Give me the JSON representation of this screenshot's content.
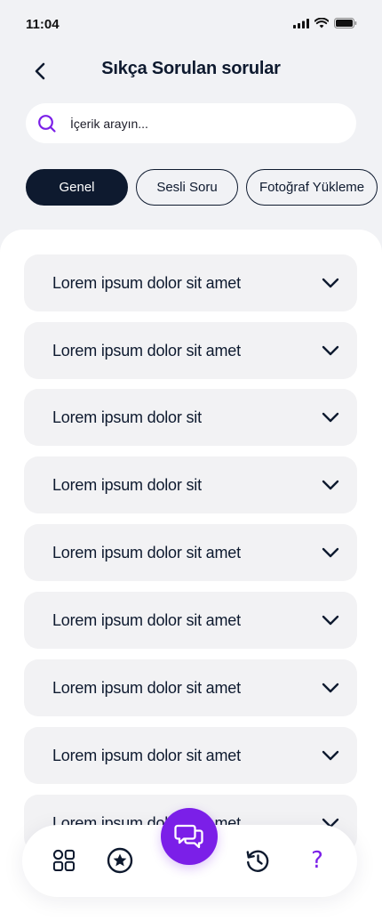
{
  "status_bar": {
    "time": "11:04"
  },
  "header": {
    "title": "Sıkça Sorulan sorular"
  },
  "search": {
    "placeholder": "İçerik arayın..."
  },
  "filters": {
    "chips": [
      {
        "label": "Genel",
        "active": true
      },
      {
        "label": "Sesli Soru",
        "active": false
      },
      {
        "label": "Fotoğraf Yükleme",
        "active": false
      }
    ]
  },
  "faq": {
    "items": [
      {
        "question": "Lorem ipsum dolor sit amet"
      },
      {
        "question": "Lorem ipsum dolor sit amet"
      },
      {
        "question": "Lorem ipsum dolor sit"
      },
      {
        "question": "Lorem ipsum dolor sit"
      },
      {
        "question": "Lorem ipsum dolor sit amet"
      },
      {
        "question": "Lorem ipsum dolor sit amet"
      },
      {
        "question": "Lorem ipsum dolor sit amet"
      },
      {
        "question": "Lorem ipsum dolor sit amet"
      },
      {
        "question": "Lorem ipsum dolor sit amet"
      }
    ]
  },
  "bottom_nav": {
    "items": [
      {
        "icon": "grid-icon"
      },
      {
        "icon": "star-circle-icon"
      },
      {
        "icon": "chat-bubbles-icon"
      },
      {
        "icon": "history-icon"
      },
      {
        "icon": "question-mark-icon",
        "label": "?"
      }
    ]
  },
  "colors": {
    "primary_dark": "#0e1a2f",
    "accent_purple": "#7b1fe8",
    "background": "#f1f2f5",
    "card": "#f2f2f4"
  }
}
